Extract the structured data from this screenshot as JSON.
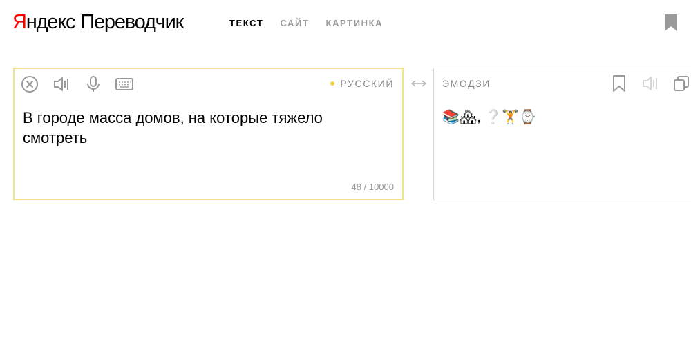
{
  "header": {
    "logo_brand_first": "Я",
    "logo_brand_rest": "ндекс",
    "logo_service": "Переводчик",
    "tabs": [
      {
        "label": "ТЕКСТ",
        "active": true
      },
      {
        "label": "САЙТ",
        "active": false
      },
      {
        "label": "КАРТИНКА",
        "active": false
      }
    ],
    "bookmark_icon": "bookmark-icon"
  },
  "source": {
    "language": "РУССКИЙ",
    "text": "В городе масса домов, на которые тяжело смотреть",
    "counter": "48 / 10000",
    "icons": [
      "clear-icon",
      "speaker-icon",
      "microphone-icon",
      "keyboard-icon"
    ]
  },
  "target": {
    "language": "ЭМОДЗИ",
    "output": "📚🏘, ❔🏋⌚",
    "icons": [
      "bookmark-icon",
      "speaker-icon",
      "copy-icon"
    ]
  },
  "colors": {
    "accent_yellow": "#f5e28c",
    "lang_dot": "#f5d33f",
    "brand_red": "#ff0000",
    "muted": "#999999"
  }
}
